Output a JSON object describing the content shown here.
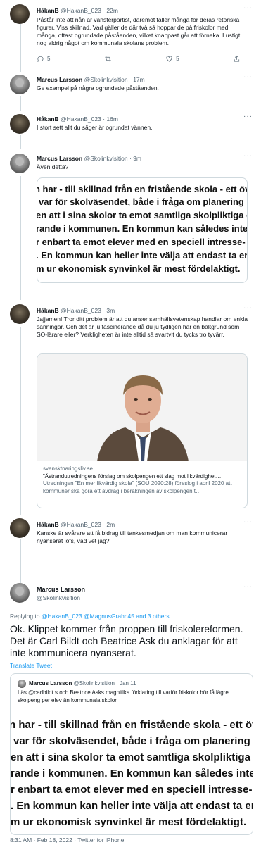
{
  "clipped_text_image": {
    "lines": [
      "n har - till skillnad från en fristående skola - ett öv",
      "var för skolväsendet, både i fråga om planering o",
      "en att i sina skolor ta emot samtliga skolpliktiga el",
      "rande i kommunen. En kommun kan således inte",
      "r enbart ta emot elever med en speciell intresse- e",
      ". En kommun kan heller inte välja att endast ta en",
      "m ur ekonomisk synvinkel är mest fördelaktigt."
    ]
  },
  "tweets": [
    {
      "name": "HåkanB",
      "handle": "@HakanB_023",
      "time": "22m",
      "text": "Påstår inte att nån är vänsterpartist, däremot faller många för deras retoriska figurer. Viss skillnad. Vad gäller de där två så hoppar de på friskolor med många, oftast ogrundade påståenden, vilket knappast går att förneka. Lustigt nog aldrig något om kommunala skolans problem.",
      "reply_count": "5",
      "like_count": "5"
    },
    {
      "name": "Marcus Larsson",
      "handle": "@Skolinkvisition",
      "time": "17m",
      "text": "Ge exempel på några ogrundade påståenden."
    },
    {
      "name": "HåkanB",
      "handle": "@HakanB_023",
      "time": "16m",
      "text": "I stort sett allt du säger är ogrundat vännen."
    },
    {
      "name": "Marcus Larsson",
      "handle": "@Skolinkvisition",
      "time": "9m",
      "text": "Även detta?"
    },
    {
      "name": "HåkanB",
      "handle": "@HakanB_023",
      "time": "3m",
      "text": "Jajjamen! Tror ditt problem är att du anser samhällsvetenskap handlar om enkla sanningar. Och det är ju fascinerande då du ju tydligen har en bakgrund som SO-lärare eller? Verkligheten är inte alltid så svartvit du tycks tro tyvärr.",
      "card": {
        "domain": "svensktnaringsliv.se",
        "title": "”Ästrandutredningens förslag om skolpengen ett slag mot likvärdighet…",
        "desc": "Utredningen ”En mer likvärdig skola” (SOU 2020:28) föreslog i april 2020 att kommuner ska göra ett avdrag i beräkningen av skolpengen t…"
      }
    },
    {
      "name": "HåkanB",
      "handle": "@HakanB_023",
      "time": "2m",
      "text": "Kanske är svårare att få bidrag till tankesmedjan om man kommunicerar nyanserat iofs, vad vet jag?"
    }
  ],
  "main_tweet": {
    "name": "Marcus Larsson",
    "handle": "@Skolinkvisition",
    "reply_prefix": "Replying to",
    "reply_targets": "@HakanB_023 @MagnusGrahn45 and 3 others",
    "text": "Ok. Klippet kommer från proppen till friskolereformen. Det är Carl Bildt och Beatrice Ask du anklagar för att inte kommunicera nyanserat.",
    "translate": "Translate Tweet",
    "quote": {
      "name": "Marcus Larsson",
      "handle": "@Skolinkvisition",
      "date": "· Jan 11",
      "text": "Läs @carlbildt s och Beatrice Asks magnifika förklaring till varför friskolor bör få lägre skolpeng per elev än kommunala skolor."
    },
    "footer": "8:31 AM · Feb 18, 2022 · Twitter for iPhone"
  }
}
